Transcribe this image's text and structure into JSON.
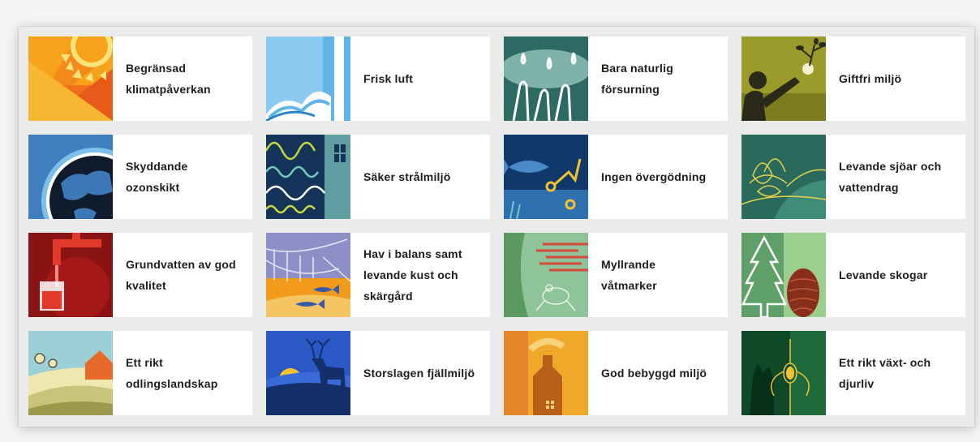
{
  "goals": [
    {
      "id": "begransad-klimatpaverkan",
      "label": "Begränsad\nklimatpåverkan",
      "icon": "sun-rays-icon"
    },
    {
      "id": "frisk-luft",
      "label": "Frisk luft",
      "icon": "cloud-air-icon"
    },
    {
      "id": "bara-naturlig-forsurning",
      "label": "Bara naturlig\nförsurning",
      "icon": "rain-drops-icon"
    },
    {
      "id": "giftfri-miljo",
      "label": "Giftfri miljö",
      "icon": "person-plant-icon"
    },
    {
      "id": "skyddande-ozonskikt",
      "label": "Skyddande\nozonskikt",
      "icon": "earth-globe-icon"
    },
    {
      "id": "saker-stralmiljo",
      "label": "Säker strålmiljö",
      "icon": "radiation-waves-icon"
    },
    {
      "id": "ingen-overgodning",
      "label": "Ingen övergödning",
      "icon": "fish-nutrients-icon"
    },
    {
      "id": "levande-sjoar-och-vattendrag",
      "label": "Levande sjöar och\nvattendrag",
      "icon": "water-lily-icon"
    },
    {
      "id": "grundvatten-av-god-kvalitet",
      "label": "Grundvatten av god\nkvalitet",
      "icon": "water-tap-icon"
    },
    {
      "id": "hav-i-balans",
      "label": "Hav i balans samt\nlevande kust och\nskärgård",
      "icon": "boat-fish-icon"
    },
    {
      "id": "myllrande-vatmarker",
      "label": "Myllrande\nvåtmarker",
      "icon": "frog-wetland-icon"
    },
    {
      "id": "levande-skogar",
      "label": "Levande skogar",
      "icon": "pine-cone-icon"
    },
    {
      "id": "ett-rikt-odlingslandskap",
      "label": "Ett rikt\nodlingslandskap",
      "icon": "farm-landscape-icon"
    },
    {
      "id": "storslagen-fjallmiljo",
      "label": "Storslagen fjällmiljö",
      "icon": "reindeer-mountain-icon"
    },
    {
      "id": "god-bebyggd-miljo",
      "label": "God bebyggd miljö",
      "icon": "city-building-icon"
    },
    {
      "id": "ett-rikt-vaxt-och-djurliv",
      "label": "Ett rikt växt- och\ndjurliv",
      "icon": "lynx-orchid-icon"
    }
  ],
  "colors": {
    "panel": "#ebebeb",
    "card": "#ffffff",
    "text": "#1d1d1d"
  }
}
